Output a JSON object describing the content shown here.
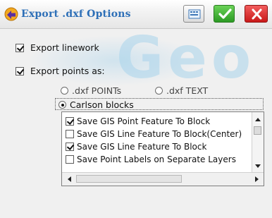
{
  "dialog": {
    "title": "Export .dxf Options",
    "title_icon": "arrow-app-icon",
    "buttons": {
      "keyboard": {
        "icon": "keyboard-icon"
      },
      "ok": {
        "icon": "checkmark-icon"
      },
      "close": {
        "icon": "close-icon"
      }
    },
    "watermark": "Geo"
  },
  "options": {
    "export_linework": {
      "label": "Export linework",
      "checked": true
    },
    "export_points": {
      "label": "Export points as:",
      "checked": true
    }
  },
  "points_mode": {
    "selected": "Carlson blocks",
    "choices": [
      {
        "label": ".dxf POINTs",
        "selected": false
      },
      {
        "label": ".dxf TEXT",
        "selected": false
      },
      {
        "label": "Carlson blocks",
        "selected": true
      }
    ]
  },
  "block_options": [
    {
      "label": "Save GIS Point Feature To Block",
      "checked": true
    },
    {
      "label": "Save GIS Line Feature To Block(Center)",
      "checked": false
    },
    {
      "label": "Save GIS Line Feature To Block",
      "checked": true
    },
    {
      "label": "Save Point Labels on Separate Layers",
      "checked": false
    }
  ],
  "colors": {
    "title": "#2d6fb7",
    "ok_button": "#2c9a24",
    "close_button": "#c91a1a",
    "watermark": "#a9d4ec"
  }
}
